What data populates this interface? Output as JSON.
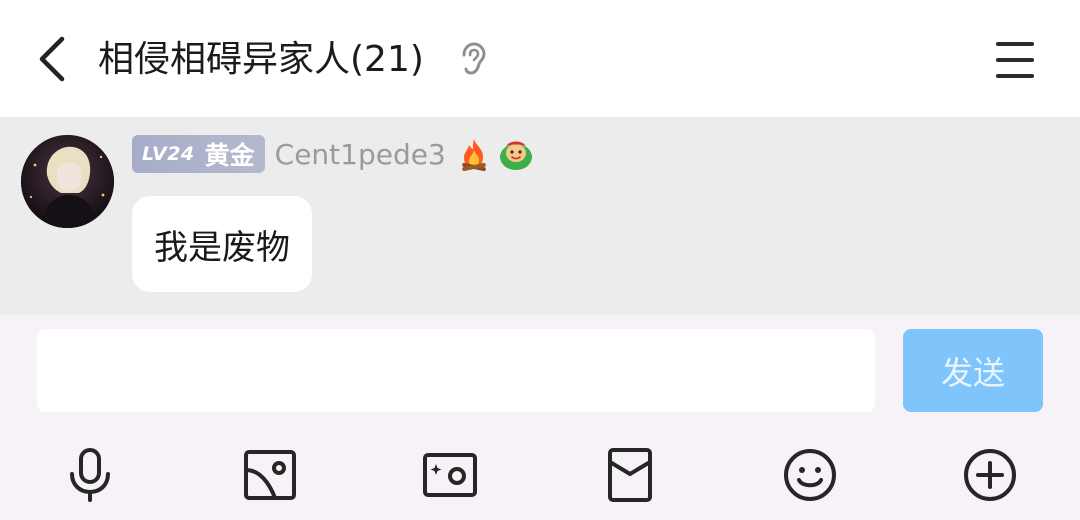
{
  "header": {
    "back_icon": "chevron-left-icon",
    "title": "相侵相碍异家人(21)",
    "ear_icon": "ear-icon",
    "menu_icon": "menu-icon"
  },
  "message": {
    "avatar": "avatar",
    "level": "LV24",
    "rank": "黄金",
    "username": "Cent1pede3",
    "badges": [
      "fire-icon",
      "face-mask-icon"
    ],
    "text": "我是废物"
  },
  "composer": {
    "input_value": "",
    "input_placeholder": "",
    "send_label": "发送"
  },
  "toolbar": {
    "items": [
      "microphone-icon",
      "image-icon",
      "camera-icon",
      "red-packet-icon",
      "emoji-icon",
      "plus-icon"
    ]
  },
  "colors": {
    "chat_bg": "#ececec",
    "composer_bg": "#f7f2f7",
    "send_button": "#7fc4fb",
    "level_badge": "#a7adc8",
    "username": "#9a9a9a"
  }
}
